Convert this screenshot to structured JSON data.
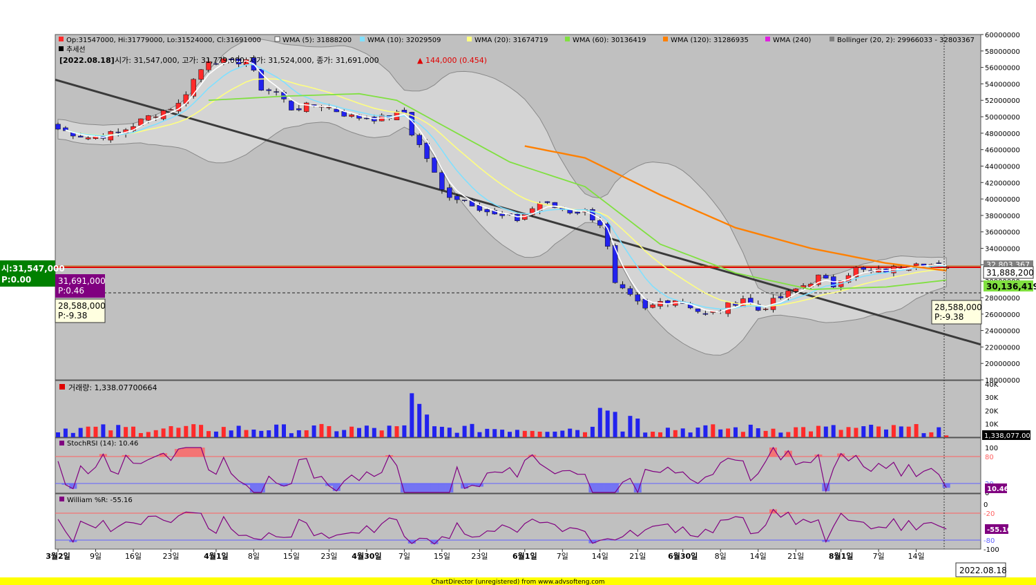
{
  "legend": {
    "ohlc": "Op:31547000, Hi:31779000, Lo:31524000, Cl:31691000",
    "wma5": "WMA (5): 31888200",
    "wma10": "WMA (10): 32029509",
    "wma20": "WMA (20): 31674719",
    "wma60": "WMA (60): 30136419",
    "wma120": "WMA (120): 31286935",
    "wma240": "WMA (240)",
    "bollinger": "Bollinger (20, 2): 29966033 - 32803367",
    "trend": "추세선",
    "info_date": "[2022.08.18]",
    "info_values": "시가: 31,547,000, 고가: 31,779,000, 저가: 31,524,000, 종가: 31,691,000",
    "info_change": "▲ 144,000 (0.454)"
  },
  "colors": {
    "panel_bg": "#c0c0c0",
    "up": "#ff2a2a",
    "down": "#2222ee",
    "wma5": "#ffffff",
    "wma10": "#80e0ff",
    "wma20": "#ffff80",
    "wma60": "#80e040",
    "wma120": "#ff8000",
    "trendline": "#3a3a3a",
    "stoch": "#800080",
    "over": "#ff6060",
    "under": "#6060ff",
    "label_green": "#008000",
    "label_purple": "#800080",
    "footer_bg": "#ffff00"
  },
  "left_labels": {
    "open": "시:31,547,000",
    "open_p": "P:0.00",
    "close": "31,691,000",
    "close_p": "P:0.46",
    "level": "28,588,000",
    "level_p": "P:-9.38"
  },
  "right_labels": {
    "boll_upper": "32,803,367",
    "wma5": "31,888,200",
    "wma60": "30,136,419",
    "level": "28,588,000",
    "level_p": "P:-9.38",
    "volume": "1,338,077.00",
    "stoch": "10.46",
    "williams": "-55.16"
  },
  "volume_header": "거래량: 1,338.07700664",
  "stoch_header": "StochRSI (14): 10.46",
  "williams_header": "William %R: -55.16",
  "footer": "ChartDirector (unregistered) from www.advsofteng.com",
  "date_box": "2022.08.18",
  "price_axis_ticks": [
    "60000000",
    "58000000",
    "56000000",
    "54000000",
    "52000000",
    "50000000",
    "48000000",
    "46000000",
    "44000000",
    "42000000",
    "40000000",
    "38000000",
    "36000000",
    "34000000",
    "32000000",
    "30000000",
    "28000000",
    "26000000",
    "24000000",
    "22000000",
    "20000000",
    "18000000"
  ],
  "volume_axis_ticks": [
    "40K",
    "30K",
    "20K",
    "10K"
  ],
  "stoch_axis_ticks": [
    "100",
    "80",
    "20",
    "0"
  ],
  "williams_axis_ticks": [
    "0",
    "-20",
    "-80",
    "-100"
  ],
  "x_ticks": [
    {
      "label": "3월2일",
      "i": 0,
      "bold": true
    },
    {
      "label": "9일",
      "i": 5,
      "bold": false
    },
    {
      "label": "16일",
      "i": 10,
      "bold": false
    },
    {
      "label": "23일",
      "i": 15,
      "bold": false
    },
    {
      "label": "4월1일",
      "i": 21,
      "bold": true
    },
    {
      "label": "8일",
      "i": 26,
      "bold": false
    },
    {
      "label": "15일",
      "i": 31,
      "bold": false
    },
    {
      "label": "23일",
      "i": 36,
      "bold": false
    },
    {
      "label": "4월30일",
      "i": 41,
      "bold": true
    },
    {
      "label": "7일",
      "i": 46,
      "bold": false
    },
    {
      "label": "15일",
      "i": 51,
      "bold": false
    },
    {
      "label": "23일",
      "i": 56,
      "bold": false
    },
    {
      "label": "6월1일",
      "i": 62,
      "bold": true
    },
    {
      "label": "7일",
      "i": 67,
      "bold": false
    },
    {
      "label": "14일",
      "i": 72,
      "bold": false
    },
    {
      "label": "21일",
      "i": 77,
      "bold": false
    },
    {
      "label": "6월30일",
      "i": 83,
      "bold": true
    },
    {
      "label": "8일",
      "i": 88,
      "bold": false
    },
    {
      "label": "14일",
      "i": 93,
      "bold": false
    },
    {
      "label": "21일",
      "i": 98,
      "bold": false
    },
    {
      "label": "8월1일",
      "i": 104,
      "bold": true
    },
    {
      "label": "7일",
      "i": 109,
      "bold": false
    },
    {
      "label": "14일",
      "i": 114,
      "bold": false
    }
  ],
  "chart_data": {
    "type": "candlestick",
    "period": "daily, 2022-03-02 to 2022-08-18",
    "y_range": [
      18000000,
      60000000
    ],
    "anchors_close": [
      [
        0,
        48500000
      ],
      [
        4,
        47500000
      ],
      [
        8,
        48000000
      ],
      [
        12,
        50000000
      ],
      [
        16,
        51500000
      ],
      [
        18,
        54500000
      ],
      [
        20,
        57000000
      ],
      [
        23,
        56500000
      ],
      [
        25,
        57000000
      ],
      [
        27,
        53500000
      ],
      [
        29,
        53000000
      ],
      [
        31,
        51000000
      ],
      [
        35,
        51500000
      ],
      [
        39,
        50000000
      ],
      [
        43,
        49800000
      ],
      [
        46,
        50500000
      ],
      [
        47,
        48000000
      ],
      [
        49,
        45000000
      ],
      [
        51,
        41000000
      ],
      [
        52,
        40500000
      ],
      [
        55,
        39500000
      ],
      [
        58,
        38000000
      ],
      [
        61,
        37500000
      ],
      [
        64,
        39500000
      ],
      [
        68,
        38500000
      ],
      [
        70,
        38500000
      ],
      [
        72,
        37000000
      ],
      [
        73,
        34000000
      ],
      [
        74,
        29500000
      ],
      [
        76,
        28000000
      ],
      [
        78,
        26500000
      ],
      [
        80,
        27500000
      ],
      [
        82,
        27800000
      ],
      [
        84,
        27000000
      ],
      [
        86,
        25800000
      ],
      [
        88,
        26500000
      ],
      [
        91,
        28000000
      ],
      [
        93,
        26500000
      ],
      [
        95,
        27500000
      ],
      [
        97,
        28500000
      ],
      [
        99,
        29500000
      ],
      [
        101,
        30500000
      ],
      [
        103,
        29500000
      ],
      [
        104,
        30500000
      ],
      [
        106,
        31500000
      ],
      [
        108,
        31000000
      ],
      [
        111,
        31500000
      ],
      [
        114,
        32500000
      ],
      [
        116,
        32000000
      ],
      [
        118,
        31691000
      ]
    ],
    "last_candle": {
      "date": "2022.08.18",
      "open": 31547000,
      "high": 31779000,
      "low": 31524000,
      "close": 31691000,
      "volume": 1338.07700664
    },
    "wma60_anchors": [
      [
        20,
        52000000
      ],
      [
        30,
        52500000
      ],
      [
        40,
        52800000
      ],
      [
        45,
        52000000
      ],
      [
        50,
        49500000
      ],
      [
        60,
        44500000
      ],
      [
        70,
        41500000
      ],
      [
        75,
        38000000
      ],
      [
        80,
        34500000
      ],
      [
        90,
        31000000
      ],
      [
        100,
        29000000
      ],
      [
        110,
        29300000
      ],
      [
        118,
        30136419
      ]
    ],
    "wma120_anchors": [
      [
        60,
        46800000
      ],
      [
        70,
        45000000
      ],
      [
        80,
        40500000
      ],
      [
        90,
        36500000
      ],
      [
        100,
        34000000
      ],
      [
        110,
        32200000
      ],
      [
        118,
        31286935
      ]
    ],
    "trendline": {
      "start": [
        0,
        54500000
      ],
      "end": [
        120,
        22300000
      ]
    },
    "horizontal_lines": [
      31691000,
      28588000
    ],
    "volume_range": [
      0,
      42000
    ],
    "volume_peaks": [
      [
        47,
        33000
      ],
      [
        48,
        25000
      ],
      [
        49,
        17000
      ],
      [
        72,
        22000
      ],
      [
        73,
        20000
      ],
      [
        74,
        19000
      ],
      [
        76,
        16000
      ],
      [
        77,
        14000
      ]
    ],
    "stoch_rsi_range": [
      0,
      100
    ],
    "stoch_rsi_levels": [
      80,
      20
    ],
    "williams_range": [
      -100,
      0
    ],
    "williams_levels": [
      -20,
      -80
    ]
  }
}
